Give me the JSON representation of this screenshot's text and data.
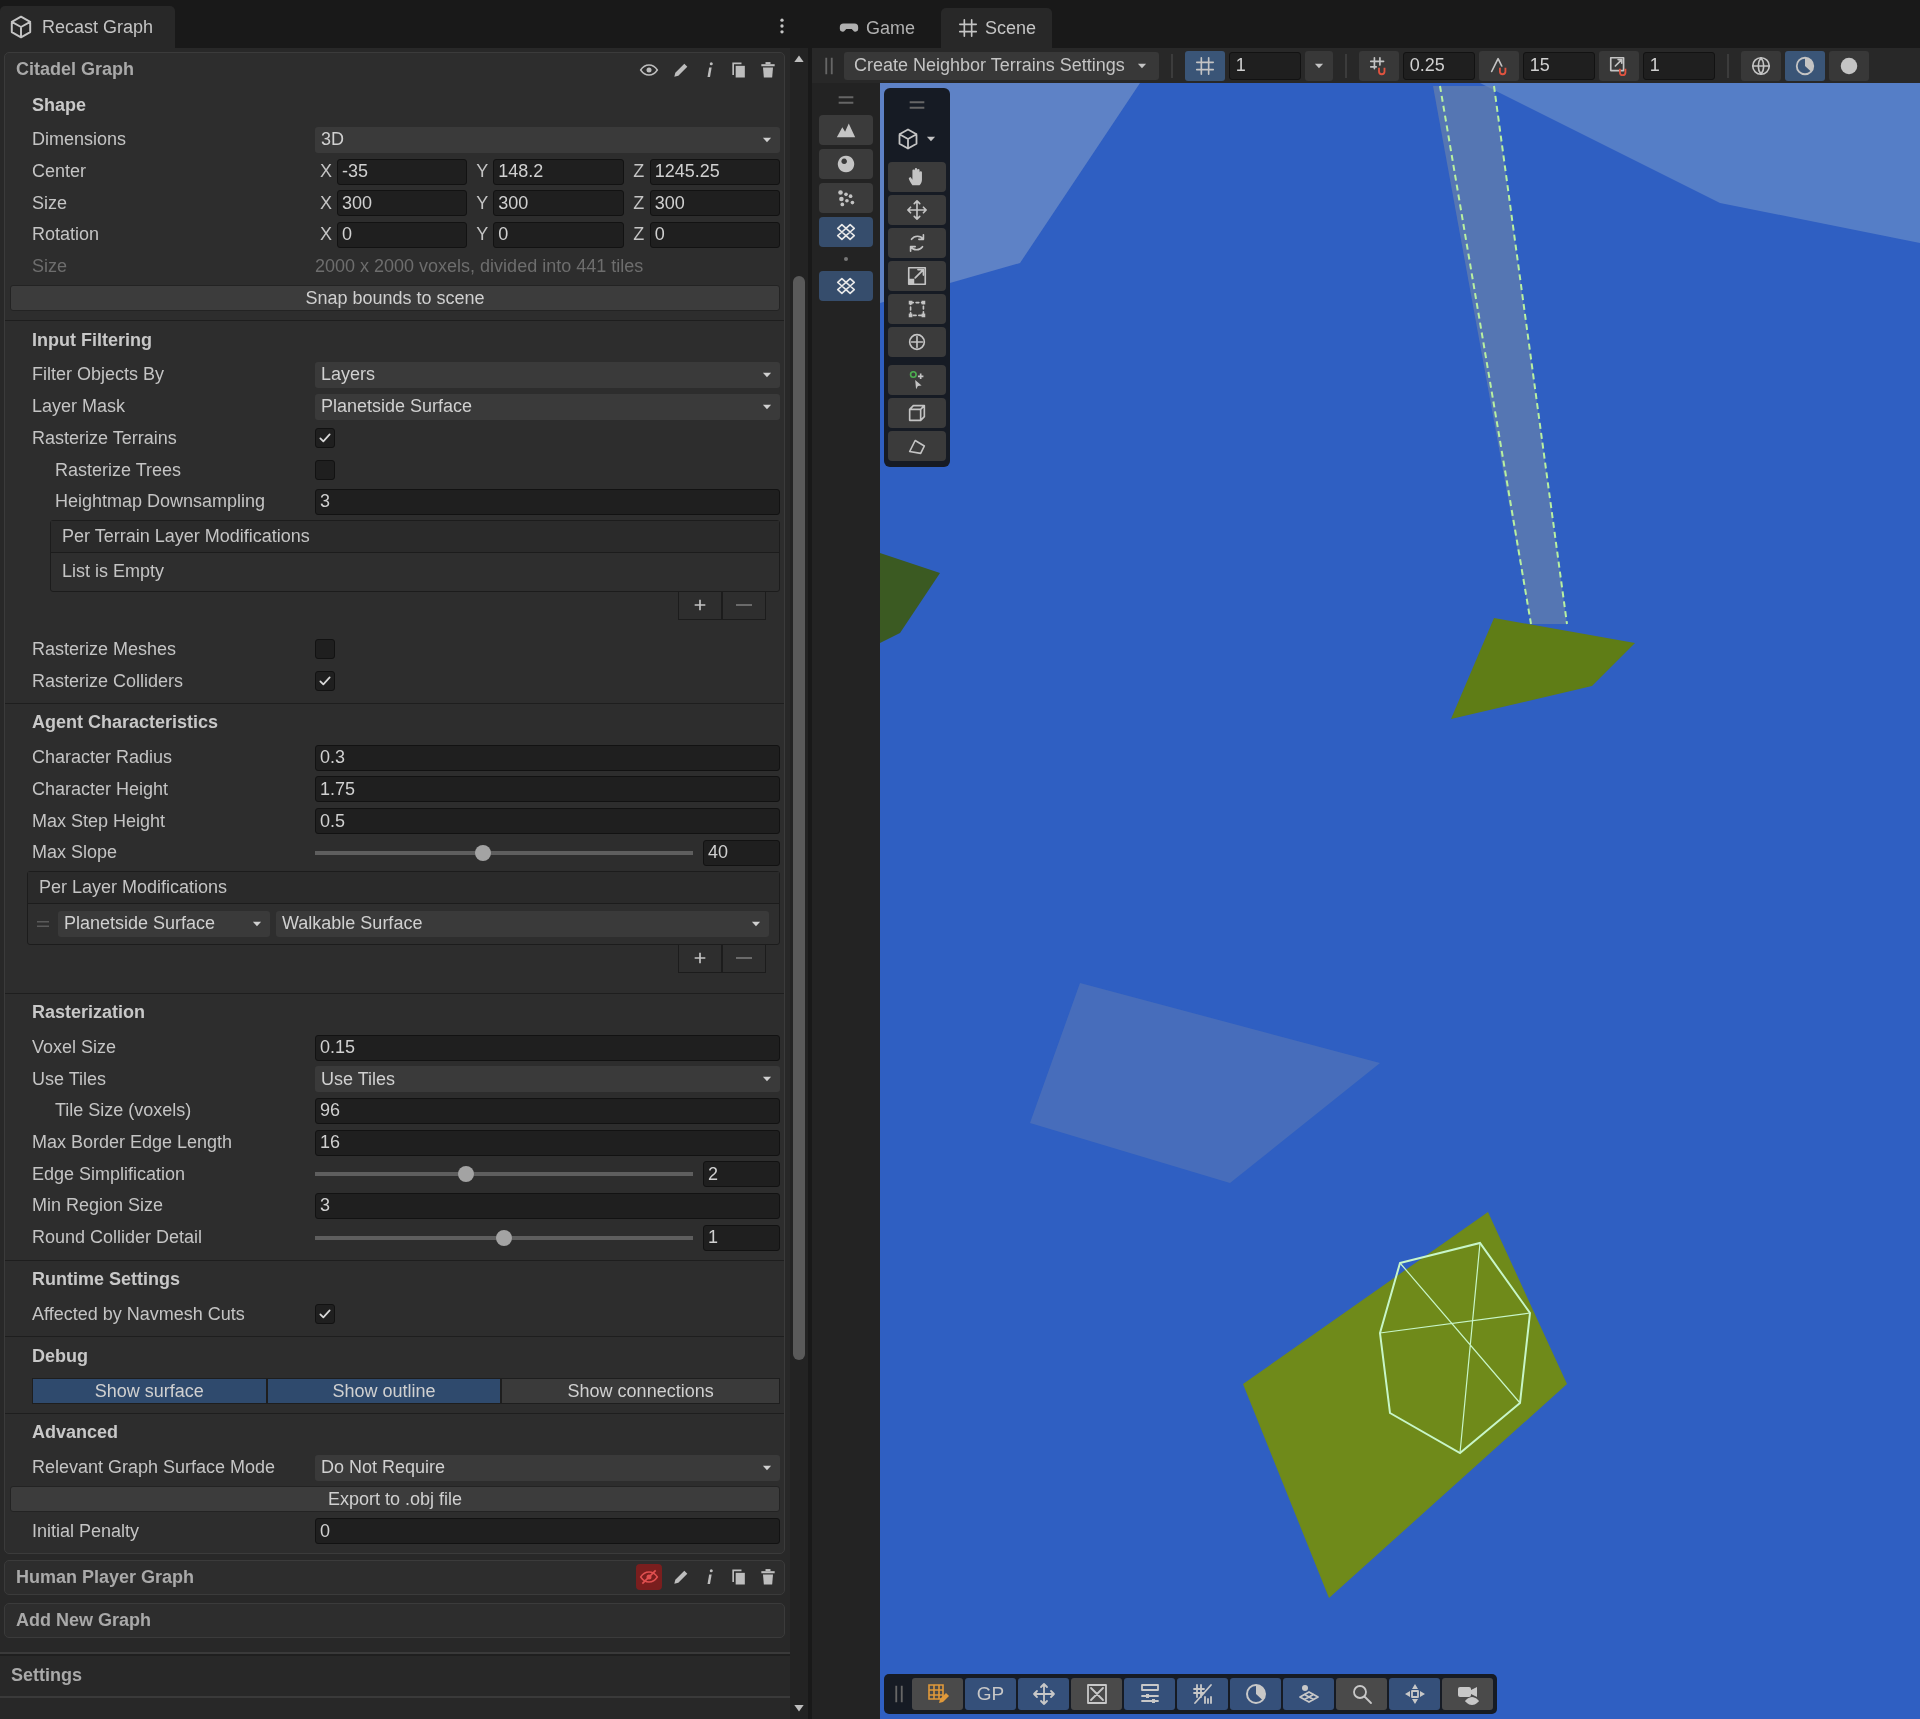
{
  "panel_tab": {
    "title": "Recast Graph"
  },
  "view_tabs": [
    {
      "label": "Game",
      "selected": false
    },
    {
      "label": "Scene",
      "selected": true
    }
  ],
  "graphs": [
    {
      "name": "Citadel Graph",
      "visible": true,
      "sections": [
        {
          "title": "Shape",
          "rows": [
            {
              "kind": "dropdown",
              "label": "Dimensions",
              "value": "3D"
            },
            {
              "kind": "vector",
              "label": "Center",
              "axes": [
                {
                  "axis": "X",
                  "value": "-35"
                },
                {
                  "axis": "Y",
                  "value": "148.2"
                },
                {
                  "axis": "Z",
                  "value": "1245.25"
                }
              ]
            },
            {
              "kind": "vector",
              "label": "Size",
              "axes": [
                {
                  "axis": "X",
                  "value": "300"
                },
                {
                  "axis": "Y",
                  "value": "300"
                },
                {
                  "axis": "Z",
                  "value": "300"
                }
              ]
            },
            {
              "kind": "vector",
              "label": "Rotation",
              "axes": [
                {
                  "axis": "X",
                  "value": "0"
                },
                {
                  "axis": "Y",
                  "value": "0"
                },
                {
                  "axis": "Z",
                  "value": "0"
                }
              ]
            },
            {
              "kind": "info",
              "label": "Size",
              "value": "2000 x 2000 voxels, divided into 441 tiles"
            },
            {
              "kind": "button",
              "label": "Snap bounds to scene"
            }
          ]
        },
        {
          "title": "Input Filtering",
          "rows": [
            {
              "kind": "dropdown",
              "label": "Filter Objects By",
              "value": "Layers"
            },
            {
              "kind": "dropdown",
              "label": "Layer Mask",
              "value": "Planetside Surface"
            },
            {
              "kind": "checkbox",
              "label": "Rasterize Terrains",
              "checked": true,
              "children": [
                {
                  "kind": "checkbox",
                  "label": "Rasterize Trees",
                  "checked": false
                },
                {
                  "kind": "field",
                  "label": "Heightmap Downsampling",
                  "value": "3"
                },
                {
                  "kind": "list",
                  "title": "Per Terrain Layer Modifications",
                  "empty_text": "List is Empty"
                }
              ]
            },
            {
              "kind": "checkbox",
              "label": "Rasterize Meshes",
              "checked": false
            },
            {
              "kind": "checkbox",
              "label": "Rasterize Colliders",
              "checked": true
            }
          ]
        },
        {
          "title": "Agent Characteristics",
          "rows": [
            {
              "kind": "field",
              "label": "Character Radius",
              "value": "0.3"
            },
            {
              "kind": "field",
              "label": "Character Height",
              "value": "1.75"
            },
            {
              "kind": "field",
              "label": "Max Step Height",
              "value": "0.5"
            },
            {
              "kind": "slider",
              "label": "Max Slope",
              "level": 0.445,
              "value": "40"
            },
            {
              "kind": "layer_list",
              "title": "Per Layer Modifications",
              "items": [
                {
                  "layer": "Planetside Surface",
                  "surface": "Walkable Surface"
                }
              ]
            }
          ]
        },
        {
          "title": "Rasterization",
          "rows": [
            {
              "kind": "field",
              "label": "Voxel Size",
              "value": "0.15"
            },
            {
              "kind": "dropdown",
              "label": "Use Tiles",
              "value": "Use Tiles",
              "children": [
                {
                  "kind": "field",
                  "label": "Tile Size (voxels)",
                  "value": "96"
                }
              ]
            },
            {
              "kind": "field",
              "label": "Max Border Edge Length",
              "value": "16"
            },
            {
              "kind": "slider",
              "label": "Edge Simplification",
              "level": 0.4,
              "value": "2"
            },
            {
              "kind": "field",
              "label": "Min Region Size",
              "value": "3"
            },
            {
              "kind": "slider",
              "label": "Round Collider Detail",
              "level": 0.5,
              "value": "1"
            }
          ]
        },
        {
          "title": "Runtime Settings",
          "rows": [
            {
              "kind": "checkbox",
              "label": "Affected by Navmesh Cuts",
              "checked": true
            }
          ]
        },
        {
          "title": "Debug",
          "rows": [
            {
              "kind": "toggles",
              "items": [
                {
                  "label": "Show surface",
                  "selected": true
                },
                {
                  "label": "Show outline",
                  "selected": true
                },
                {
                  "label": "Show connections",
                  "selected": false
                }
              ]
            }
          ]
        },
        {
          "title": "Advanced",
          "rows": [
            {
              "kind": "dropdown",
              "label": "Relevant Graph Surface Mode",
              "value": "Do Not Require"
            },
            {
              "kind": "button",
              "label": "Export to .obj file"
            },
            {
              "kind": "field",
              "label": "Initial Penalty",
              "value": "0"
            }
          ]
        }
      ]
    },
    {
      "name": "Human Player Graph",
      "visible": false
    }
  ],
  "add_graph": "Add New Graph",
  "footer_sections": [
    "Settings"
  ],
  "scene_toolbar": {
    "menu": "Create Neighbor Terrains Settings",
    "grid": {
      "selected": true,
      "value": "1"
    },
    "move_snap": {
      "selected": false,
      "value": "0.25"
    },
    "rotate_snap": {
      "selected": false,
      "value": "15"
    },
    "scale_snap": {
      "selected": false,
      "value": "1"
    },
    "view_buttons": [
      {
        "selected": false
      },
      {
        "selected": true
      },
      {
        "selected": false
      }
    ]
  },
  "terrain_tools": [
    {
      "selected": false
    },
    {
      "selected": false
    },
    {
      "selected": false
    },
    {
      "selected": true
    },
    {
      "selected": true
    }
  ],
  "scene_tools": [
    {
      "selected": false
    },
    {
      "selected": false
    },
    {
      "selected": false
    },
    {
      "selected": false
    },
    {
      "selected": false
    },
    {
      "selected": false
    },
    {
      "selected": false
    },
    {
      "selected": false
    },
    {
      "selected": false
    }
  ],
  "overlay_toolbar": [
    {
      "selected": false
    },
    {
      "selected": true,
      "label": "GP"
    },
    {
      "selected": true
    },
    {
      "selected": false
    },
    {
      "selected": true
    },
    {
      "selected": true
    },
    {
      "selected": true
    },
    {
      "selected": true
    },
    {
      "selected": false
    },
    {
      "selected": true
    },
    {
      "selected": false
    }
  ]
}
